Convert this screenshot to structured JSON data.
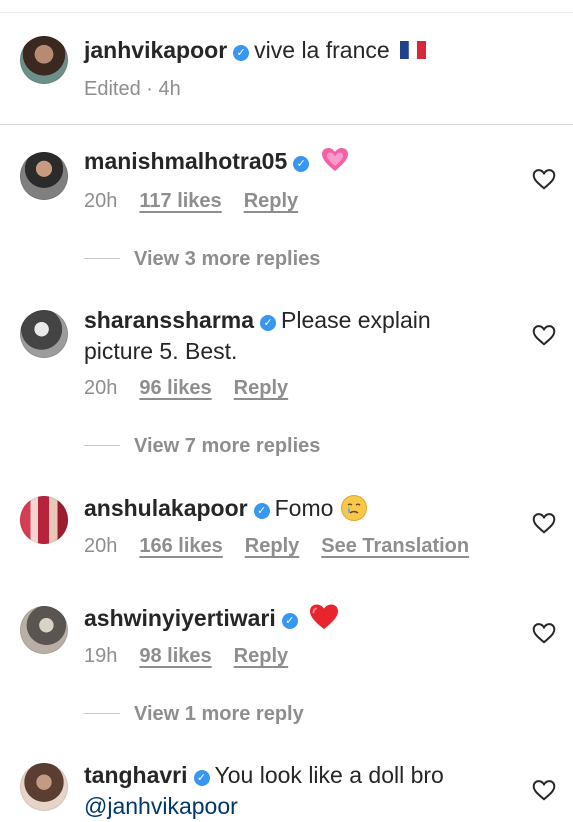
{
  "caption": {
    "username": "janhvikapoor",
    "text": "vive la france",
    "meta": "Edited · 4h"
  },
  "comments": [
    {
      "username": "manishmalhotra05",
      "text": "",
      "time": "20h",
      "likes": "117 likes",
      "reply": "Reply",
      "view_more": "View 3 more replies"
    },
    {
      "username": "sharanssharma",
      "text": "Please explain",
      "text2": "picture 5. Best.",
      "time": "20h",
      "likes": "96 likes",
      "reply": "Reply",
      "view_more": "View 7 more replies"
    },
    {
      "username": "anshulakapoor",
      "text": "Fomo",
      "time": "20h",
      "likes": "166 likes",
      "reply": "Reply",
      "translation": "See Translation"
    },
    {
      "username": "ashwinyiyertiwari",
      "text": "",
      "time": "19h",
      "likes": "98 likes",
      "reply": "Reply",
      "view_more": "View 1 more reply"
    },
    {
      "username": "tanghavri",
      "text": "You look like a doll bro",
      "text2": "@janhvikapoor"
    }
  ],
  "icons": {
    "verified": "verified-badge-icon",
    "like": "heart-outline-icon"
  },
  "colors": {
    "verified": "#3897f0",
    "secondary_text": "#8e8e8e",
    "separator": "#dbdbdb"
  }
}
